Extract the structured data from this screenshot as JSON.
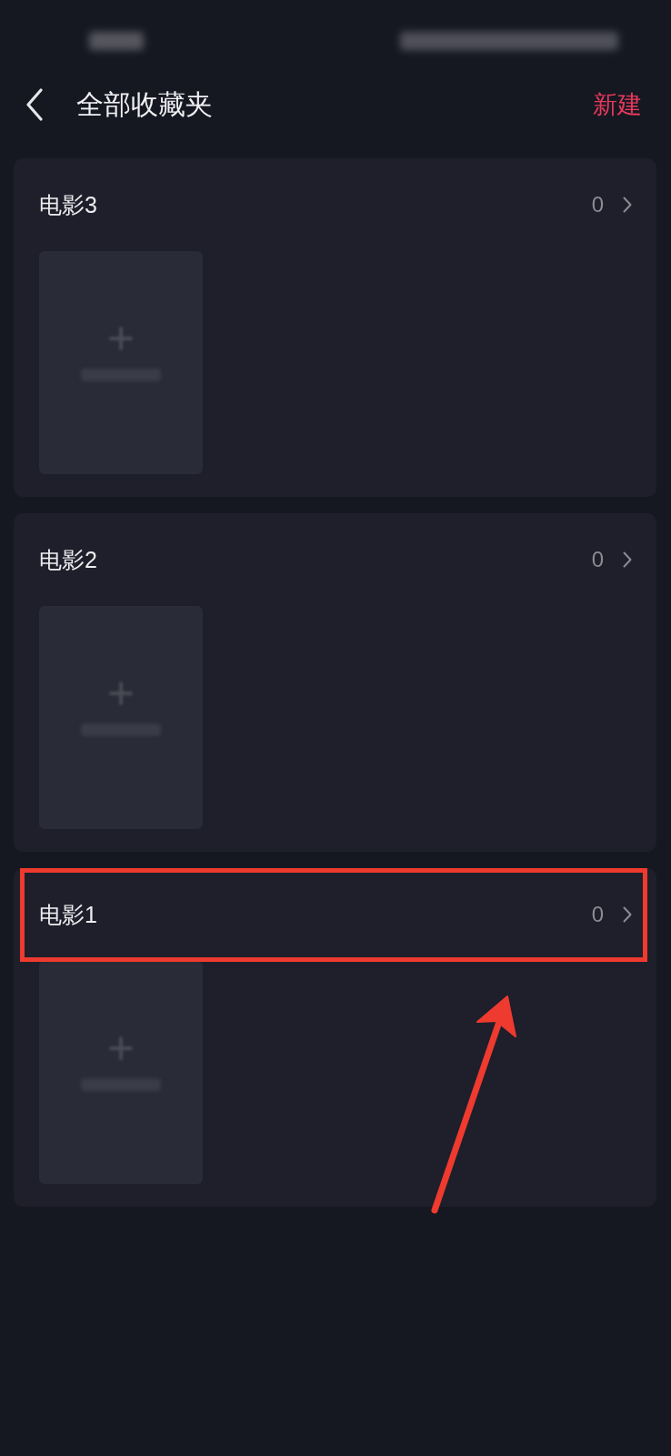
{
  "header": {
    "title": "全部收藏夹",
    "action": "新建"
  },
  "folders": [
    {
      "name": "电影3",
      "count": "0",
      "highlighted": false
    },
    {
      "name": "电影2",
      "count": "0",
      "highlighted": false
    },
    {
      "name": "电影1",
      "count": "0",
      "highlighted": true
    }
  ]
}
